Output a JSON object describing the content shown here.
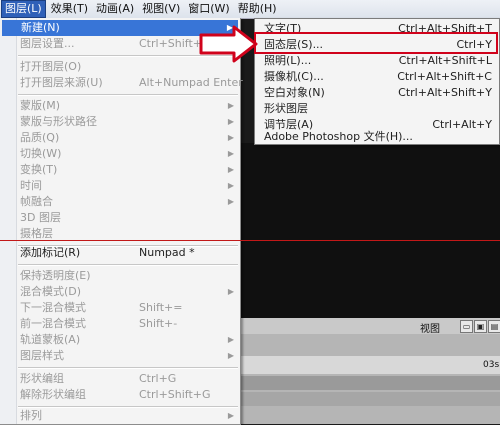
{
  "menubar": {
    "items": [
      {
        "label": "图层(L)"
      },
      {
        "label": "效果(T)"
      },
      {
        "label": "动画(A)"
      },
      {
        "label": "视图(V)"
      },
      {
        "label": "窗口(W)"
      },
      {
        "label": "帮助(H)"
      }
    ]
  },
  "layer_menu": {
    "items": [
      {
        "label": "新建(N)",
        "shortcut": "",
        "submenu": true,
        "state": "selected"
      },
      {
        "label": "图层设置...",
        "shortcut": "Ctrl+Shift+Y",
        "submenu": false,
        "state": "disabled"
      },
      {
        "label": "打开图层(O)",
        "shortcut": "",
        "submenu": false,
        "state": "disabled"
      },
      {
        "label": "打开图层来源(U)",
        "shortcut": "Alt+Numpad Enter",
        "submenu": false,
        "state": "disabled"
      },
      {
        "label": "蒙版(M)",
        "shortcut": "",
        "submenu": true,
        "state": "disabled"
      },
      {
        "label": "蒙版与形状路径",
        "shortcut": "",
        "submenu": true,
        "state": "disabled"
      },
      {
        "label": "品质(Q)",
        "shortcut": "",
        "submenu": true,
        "state": "disabled"
      },
      {
        "label": "切换(W)",
        "shortcut": "",
        "submenu": true,
        "state": "disabled"
      },
      {
        "label": "变换(T)",
        "shortcut": "",
        "submenu": true,
        "state": "disabled"
      },
      {
        "label": "时间",
        "shortcut": "",
        "submenu": true,
        "state": "disabled"
      },
      {
        "label": "帧融合",
        "shortcut": "",
        "submenu": true,
        "state": "disabled"
      },
      {
        "label": "3D 图层",
        "shortcut": "",
        "submenu": false,
        "state": "disabled"
      },
      {
        "label": "摄格层",
        "shortcut": "",
        "submenu": false,
        "state": "disabled"
      },
      {
        "label": "添加标记(R)",
        "shortcut": "Numpad *",
        "submenu": false,
        "state": "enabled"
      },
      {
        "label": "保持透明度(E)",
        "shortcut": "",
        "submenu": false,
        "state": "disabled"
      },
      {
        "label": "混合模式(D)",
        "shortcut": "",
        "submenu": true,
        "state": "disabled"
      },
      {
        "label": "下一混合模式",
        "shortcut": "Shift+=",
        "submenu": false,
        "state": "disabled"
      },
      {
        "label": "前一混合模式",
        "shortcut": "Shift+-",
        "submenu": false,
        "state": "disabled"
      },
      {
        "label": "轨道蒙板(A)",
        "shortcut": "",
        "submenu": true,
        "state": "disabled"
      },
      {
        "label": "图层样式",
        "shortcut": "",
        "submenu": true,
        "state": "disabled"
      },
      {
        "label": "形状编组",
        "shortcut": "Ctrl+G",
        "submenu": false,
        "state": "disabled"
      },
      {
        "label": "解除形状编组",
        "shortcut": "Ctrl+Shift+G",
        "submenu": false,
        "state": "disabled"
      },
      {
        "label": "排列",
        "shortcut": "",
        "submenu": true,
        "state": "disabled"
      }
    ]
  },
  "new_submenu": {
    "items": [
      {
        "label": "文字(T)",
        "shortcut": "Ctrl+Alt+Shift+T",
        "state": "enabled"
      },
      {
        "label": "固态层(S)...",
        "shortcut": "Ctrl+Y",
        "state": "highlighted"
      },
      {
        "label": "照明(L)...",
        "shortcut": "Ctrl+Alt+Shift+L",
        "state": "enabled"
      },
      {
        "label": "摄像机(C)...",
        "shortcut": "Ctrl+Alt+Shift+C",
        "state": "enabled"
      },
      {
        "label": "空白对象(N)",
        "shortcut": "Ctrl+Alt+Shift+Y",
        "state": "enabled"
      },
      {
        "label": "形状图层",
        "shortcut": "",
        "state": "enabled"
      },
      {
        "label": "调节层(A)",
        "shortcut": "Ctrl+Alt+Y",
        "state": "enabled"
      },
      {
        "label": "Adobe Photoshop 文件(H)...",
        "shortcut": "",
        "state": "enabled"
      }
    ]
  },
  "background": {
    "view_label": "视图",
    "timecode": "03s"
  },
  "colors": {
    "menu_bg": "#f4f4f4",
    "selection": "#3875d7",
    "annotation_red": "#d0021b"
  }
}
